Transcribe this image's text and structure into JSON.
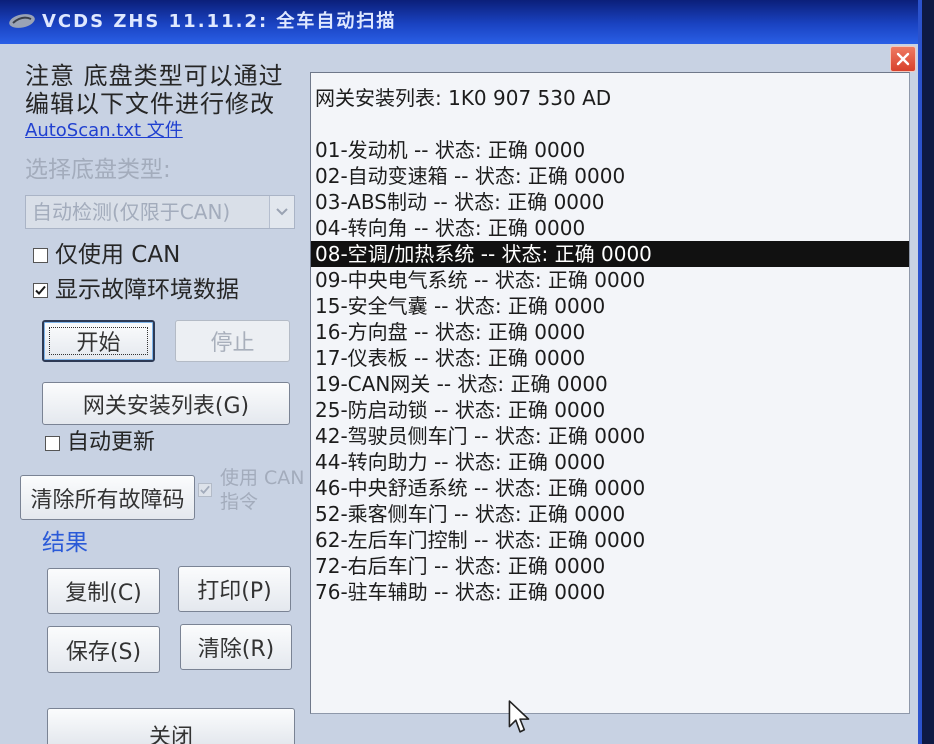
{
  "window": {
    "title": "VCDS ZHS 11.11.2: 全车自动扫描"
  },
  "left": {
    "note_line1": "注意 底盘类型可以通过",
    "note_line2": "编辑以下文件进行修改",
    "file_link": "AutoScan.txt 文件",
    "chassis_label": "选择底盘类型:",
    "chassis_select_value": "自动检测(仅限于CAN)",
    "only_can": {
      "label": "仅使用 CAN",
      "checked": false
    },
    "show_freeze_frame": {
      "label": "显示故障环境数据",
      "checked": true
    },
    "start_button": "开始",
    "stop_button": "停止",
    "gateway_list_button": "网关安装列表(G)",
    "auto_update": {
      "label": "自动更新",
      "checked": false
    },
    "clear_all_dtc_button": "清除所有故障码",
    "use_can_command": {
      "label_lines": [
        "使用 CAN",
        "指令"
      ],
      "checked": true
    },
    "results_heading": "结果",
    "copy_button": "复制(C)",
    "print_button": "打印(P)",
    "save_button": "保存(S)",
    "clear_button": "清除(R)",
    "close_button": "关闭"
  },
  "results": {
    "header": "网关安装列表: 1K0 907 530 AD",
    "selected_index": 4,
    "lines": [
      "01-发动机 -- 状态: 正确 0000",
      "02-自动变速箱 -- 状态: 正确 0000",
      "03-ABS制动 -- 状态: 正确 0000",
      "04-转向角 -- 状态: 正确 0000",
      "08-空调/加热系统 -- 状态: 正确 0000",
      "09-中央电气系统 -- 状态: 正确 0000",
      "15-安全气囊 -- 状态: 正确 0000",
      "16-方向盘 -- 状态: 正确 0000",
      "17-仪表板 -- 状态: 正确 0000",
      "19-CAN网关 -- 状态: 正确 0000",
      "25-防启动锁 -- 状态: 正确 0000",
      "42-驾驶员侧车门 -- 状态: 正确 0000",
      "44-转向助力 -- 状态: 正确 0000",
      "46-中央舒适系统 -- 状态: 正确 0000",
      "52-乘客侧车门 -- 状态: 正确 0000",
      "62-左后车门控制 -- 状态: 正确 0000",
      "72-右后车门 -- 状态: 正确 0000",
      "76-驻车辅助 -- 状态: 正确 0000"
    ]
  },
  "colors": {
    "title_bar_top": "#0b1f7a",
    "title_bar_bottom": "#2a5fe6",
    "client_bg": "#c8d2e3",
    "results_bg": "#f3f5f9",
    "selection_bg": "#111111",
    "selection_text": "#ffffff",
    "link": "#2040d0",
    "heading": "#2a5ad8",
    "disabled_text": "#a3acbc",
    "close_button": "#d8412c"
  },
  "icons": {
    "app": "vcds-app-icon",
    "close": "close-icon",
    "dropdown": "chevron-down-icon",
    "checkbox_check": "checkmark-icon",
    "pointer": "mouse-cursor-icon"
  }
}
